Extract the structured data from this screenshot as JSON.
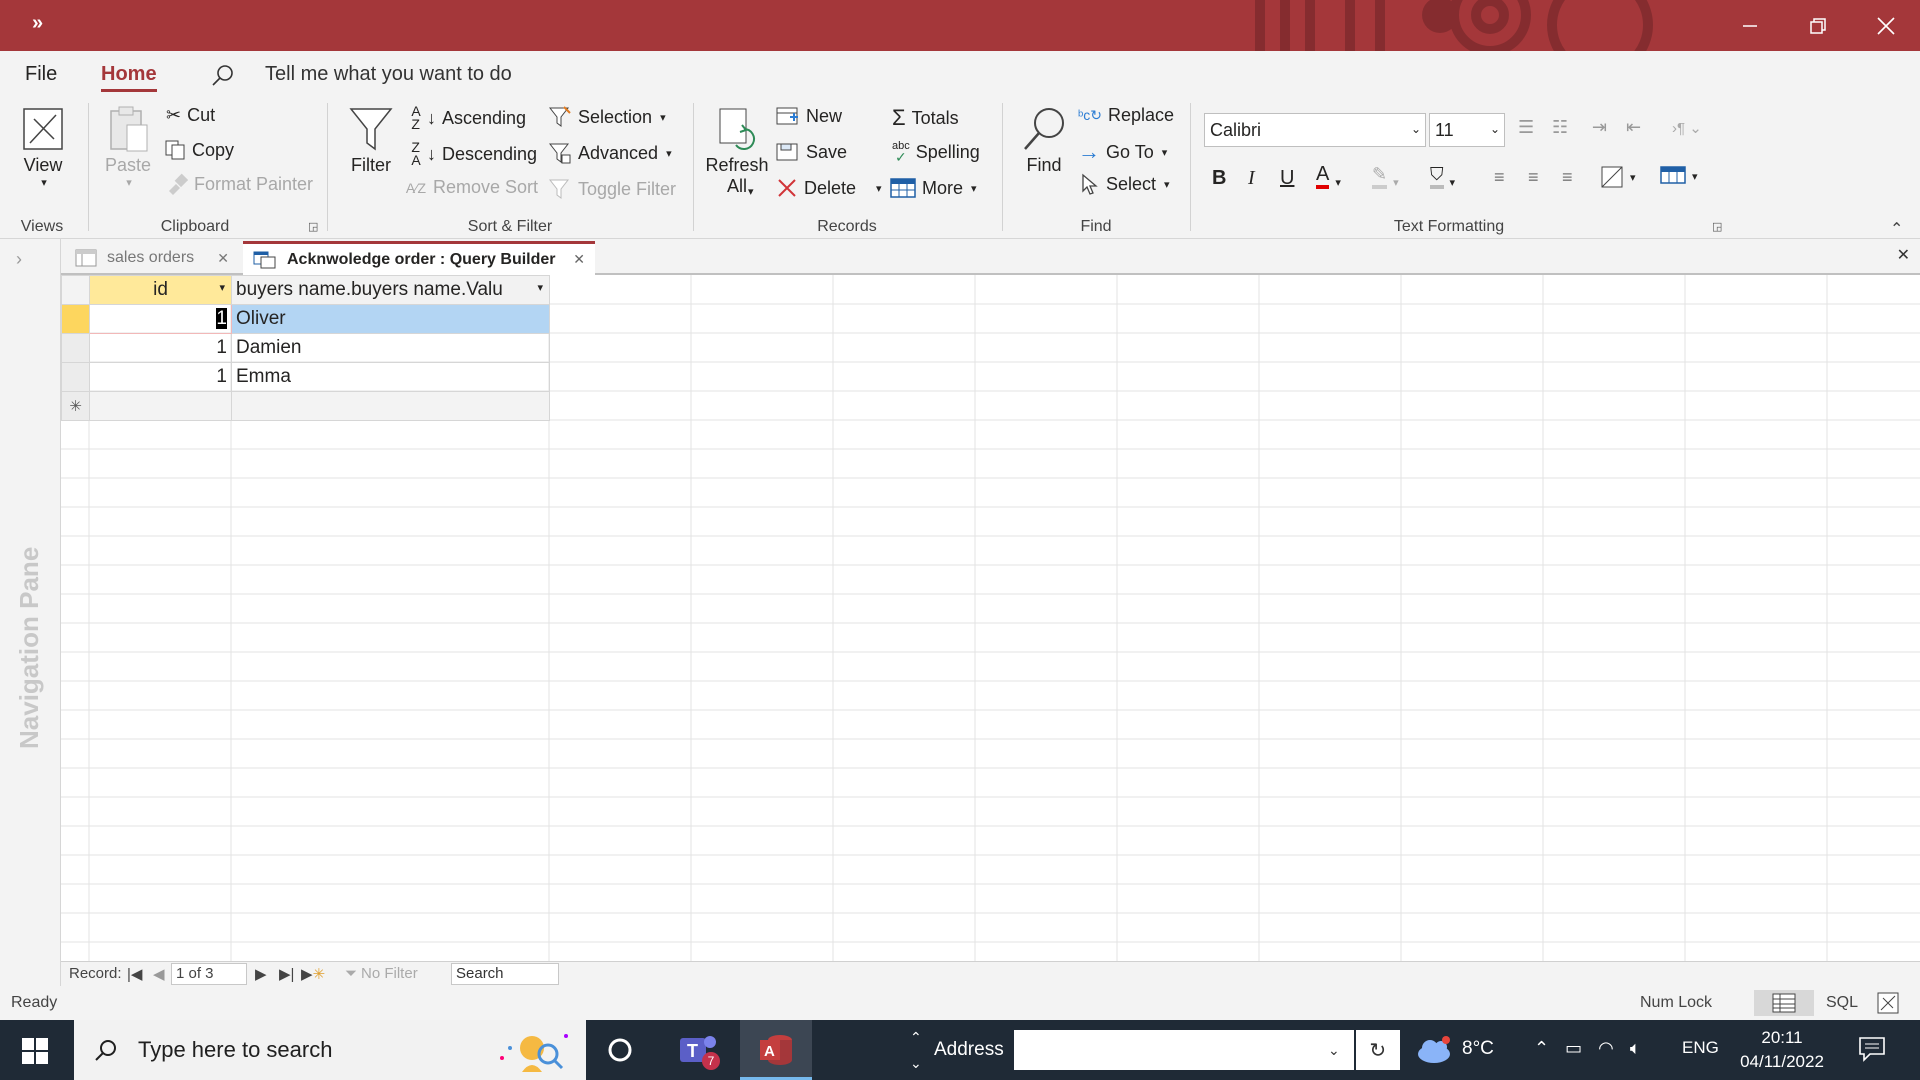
{
  "titlebar": {
    "qat_label": "»"
  },
  "ribbon_tabs": [
    {
      "label": "File"
    },
    {
      "label": "Home"
    }
  ],
  "tell_me": "Tell me what you want to do",
  "views": {
    "view_label": "View",
    "group": "Views"
  },
  "clipboard": {
    "paste": "Paste",
    "cut": "Cut",
    "copy": "Copy",
    "format_painter": "Format Painter",
    "group": "Clipboard"
  },
  "sort_filter": {
    "filter": "Filter",
    "ascending": "Ascending",
    "descending": "Descending",
    "remove_sort": "Remove Sort",
    "selection": "Selection",
    "advanced": "Advanced",
    "toggle_filter": "Toggle Filter",
    "group": "Sort & Filter"
  },
  "records": {
    "refresh_line1": "Refresh",
    "refresh_line2": "All",
    "new": "New",
    "save": "Save",
    "delete": "Delete",
    "totals": "Totals",
    "spelling": "Spelling",
    "more": "More",
    "group": "Records"
  },
  "find": {
    "find": "Find",
    "replace": "Replace",
    "goto": "Go To",
    "select": "Select",
    "group": "Find"
  },
  "text_formatting": {
    "font": "Calibri",
    "size": "11",
    "bold": "B",
    "italic": "I",
    "underline": "U",
    "group": "Text Formatting",
    "font_color": "#e00000"
  },
  "nav_pane": {
    "label": "Navigation Pane"
  },
  "doc_tabs": [
    {
      "label": "sales orders"
    },
    {
      "label": "Acknwoledge order : Query Builder"
    }
  ],
  "datasheet": {
    "columns": [
      "id",
      "buyers name.buyers name.Valu"
    ],
    "rows": [
      {
        "id": "1",
        "name": "Oliver"
      },
      {
        "id": "1",
        "name": "Damien"
      },
      {
        "id": "1",
        "name": "Emma"
      }
    ],
    "new_row_marker": "✳"
  },
  "record_nav": {
    "label": "Record:",
    "position": "1 of 3",
    "no_filter": "No Filter",
    "search": "Search"
  },
  "statusbar": {
    "status": "Ready",
    "num_lock": "Num Lock",
    "sql": "SQL"
  },
  "taskbar": {
    "search_placeholder": "Type here to search",
    "address_label": "Address",
    "teams_badge": "7",
    "weather": "8°C",
    "lang": "ENG",
    "time": "20:11",
    "date": "04/11/2022"
  },
  "colors": {
    "accent": "#a4373a",
    "selected_row": "#fdd65e",
    "selected_cell": "#b3d5f3"
  }
}
